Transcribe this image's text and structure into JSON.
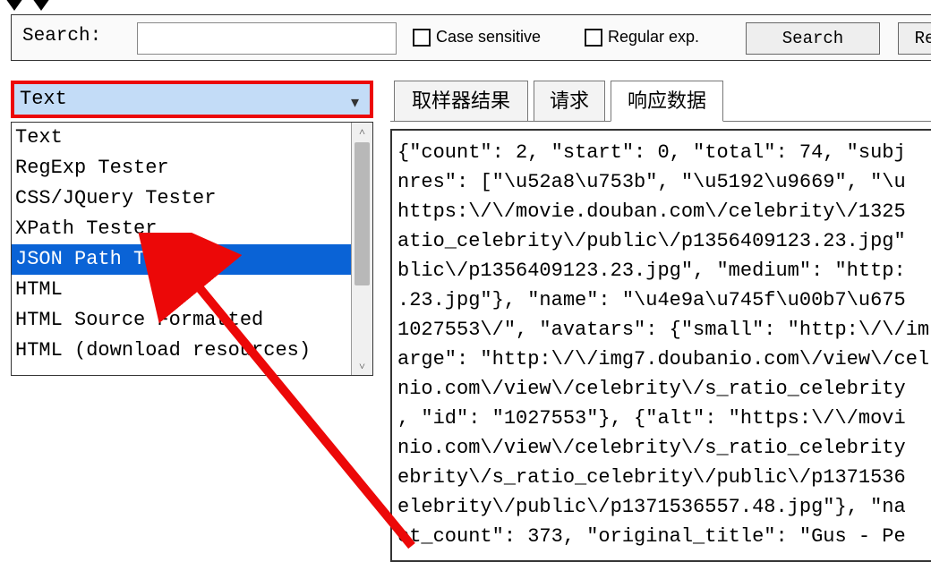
{
  "toolbar": {
    "search_label": "Search:",
    "search_value": "",
    "case_sensitive_label": "Case sensitive",
    "regular_exp_label": "Regular exp.",
    "search_button": "Search",
    "re_button": "Re"
  },
  "combo": {
    "selected": "Text",
    "options": [
      "Text",
      "RegExp Tester",
      "CSS/JQuery Tester",
      "XPath Tester",
      "JSON Path Tester",
      "HTML",
      "HTML Source Formatted",
      "HTML (download resources)"
    ],
    "highlighted_index": 4
  },
  "tabs": [
    {
      "label": "取样器结果",
      "active": false
    },
    {
      "label": "请求",
      "active": false
    },
    {
      "label": "响应数据",
      "active": true
    }
  ],
  "response_body_lines": [
    "{\"count\": 2, \"start\": 0, \"total\": 74, \"subj",
    "nres\": [\"\\u52a8\\u753b\", \"\\u5192\\u9669\", \"\\u",
    "https:\\/\\/movie.douban.com\\/celebrity\\/1325",
    "atio_celebrity\\/public\\/p1356409123.23.jpg\"",
    "blic\\/p1356409123.23.jpg\", \"medium\": \"http:",
    ".23.jpg\"}, \"name\": \"\\u4e9a\\u745f\\u00b7\\u675",
    "1027553\\/\", \"avatars\": {\"small\": \"http:\\/\\/im",
    "arge\": \"http:\\/\\/img7.doubanio.com\\/view\\/cel",
    "nio.com\\/view\\/celebrity\\/s_ratio_celebrity",
    ", \"id\": \"1027553\"}, {\"alt\": \"https:\\/\\/movi",
    "nio.com\\/view\\/celebrity\\/s_ratio_celebrity",
    "ebrity\\/s_ratio_celebrity\\/public\\/p1371536",
    "elebrity\\/public\\/p1371536557.48.jpg\"}, \"na",
    "ct_count\": 373, \"original_title\": \"Gus - Pe"
  ],
  "annotation": {
    "highlight_color": "#ec0808",
    "arrow_color": "#ec0808"
  }
}
